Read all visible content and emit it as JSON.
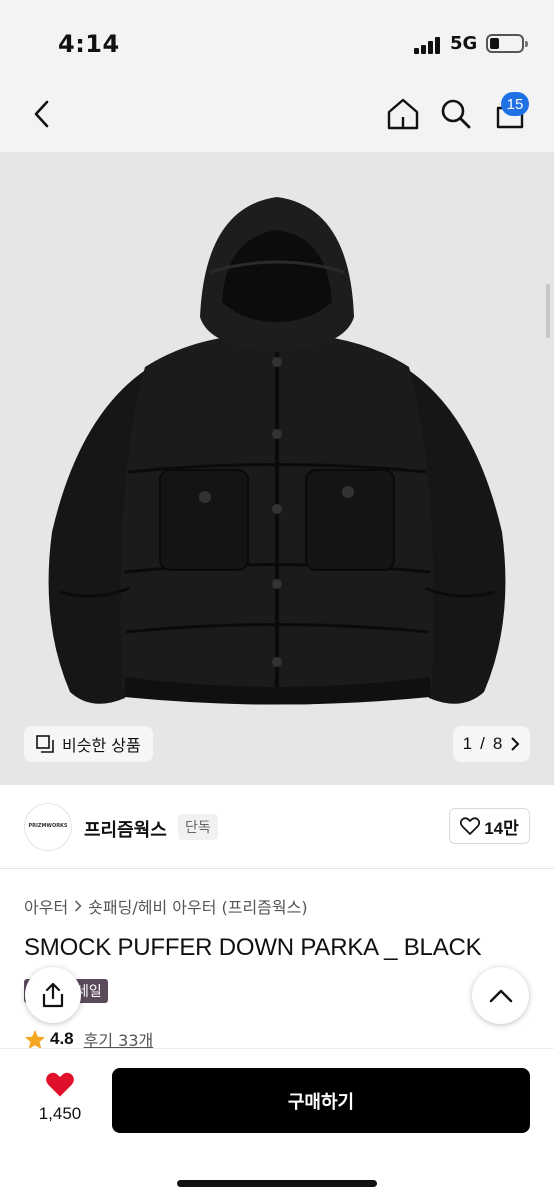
{
  "status_bar": {
    "time": "4:14",
    "network": "5G"
  },
  "nav": {
    "back_icon": "chevron-left-icon",
    "home_icon": "home-icon",
    "search_icon": "search-icon",
    "cart_icon": "cart-icon",
    "cart_count": "15"
  },
  "gallery": {
    "similar_label": "비슷한 상품",
    "current": "1",
    "separator": "/",
    "total": "8"
  },
  "brand": {
    "logo_text": "PRIZMWORKS",
    "name": "프리즘웍스",
    "tag": "단독",
    "likes": "14만"
  },
  "product": {
    "breadcrumb": [
      "아우터",
      "숏패딩/헤비 아우터 (프리즘웍스)"
    ],
    "title": "SMOCK PUFFER DOWN PARKA _ BLACK",
    "sale_badge": "세일",
    "rating": "4.8",
    "reviews": "후기 33개"
  },
  "bottom": {
    "wish_count": "1,450",
    "buy_label": "구매하기"
  },
  "colors": {
    "accent_badge": "#1f6fe5",
    "wish_heart": "#e0102b",
    "star": "#f5a623",
    "sale_badge": "#5a4a5c",
    "buy_button": "#000000"
  }
}
